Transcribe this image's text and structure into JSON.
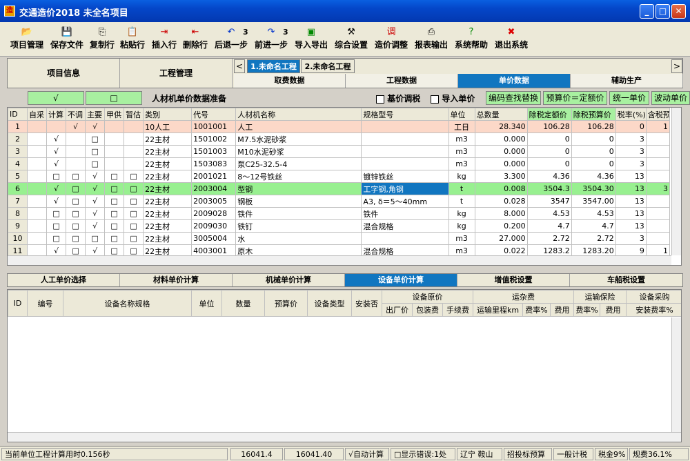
{
  "window": {
    "title": "交通造价2018  未全名项目",
    "app_icon": "造"
  },
  "toolbar": [
    {
      "label": "项目管理",
      "icon": "folder-icon",
      "glyph": "📂"
    },
    {
      "label": "保存文件",
      "icon": "save-icon",
      "glyph": "💾"
    },
    {
      "label": "复制行",
      "icon": "copy-icon",
      "glyph": "⎘"
    },
    {
      "label": "粘贴行",
      "icon": "paste-icon",
      "glyph": "📋"
    },
    {
      "label": "插入行",
      "icon": "insert-row-icon",
      "glyph": "⇥"
    },
    {
      "label": "删除行",
      "icon": "delete-row-icon",
      "glyph": "⇤"
    },
    {
      "label": "后退一步",
      "icon": "undo-icon",
      "glyph": "↶",
      "count": "3"
    },
    {
      "label": "前进一步",
      "icon": "redo-icon",
      "glyph": "↷",
      "count": "3"
    },
    {
      "label": "导入导出",
      "icon": "excel-icon",
      "glyph": "▣"
    },
    {
      "label": "综合设置",
      "icon": "tools-icon",
      "glyph": "⚒"
    },
    {
      "label": "造价调整",
      "icon": "adjust-icon",
      "glyph": "调"
    },
    {
      "label": "报表输出",
      "icon": "printer-icon",
      "glyph": "⎙"
    },
    {
      "label": "系统帮助",
      "icon": "help-icon",
      "glyph": "?"
    },
    {
      "label": "退出系统",
      "icon": "exit-icon",
      "glyph": "✖"
    }
  ],
  "nav": {
    "project_info": "项目信息",
    "project_mgmt": "工程管理",
    "file_tabs": [
      "1.未命名工程",
      "2.未命名工程"
    ],
    "sub_tabs": [
      "取费数据",
      "工程数据",
      "单价数据",
      "辅助生产"
    ]
  },
  "filter": {
    "btn_check": "√",
    "btn_box": "□",
    "title": "人材机单价数据准备",
    "chk1": "基价调税",
    "chk2": "导入单价",
    "buttons": [
      "编码查找替换",
      "预算价＝定额价",
      "统一单价",
      "波动单价"
    ]
  },
  "grid1": {
    "headers": [
      "ID",
      "自采",
      "计算",
      "不调",
      "主要",
      "甲供",
      "暂估",
      "类别",
      "代号",
      "人材机名称",
      "规格型号",
      "单位",
      "总数量",
      "除税定额价",
      "除税预算价",
      "税率(%)",
      "含税预"
    ],
    "rows": [
      [
        "1",
        "",
        "",
        "√",
        "√",
        "",
        "",
        "10人工",
        "1001001",
        "人工",
        "",
        "工日",
        "28.340",
        "106.28",
        "106.28",
        "0",
        "1"
      ],
      [
        "2",
        "",
        "√",
        "",
        "□",
        "",
        "",
        "22主材",
        "1501002",
        "M7.5水泥砂浆",
        "",
        "m3",
        "0.000",
        "0",
        "0",
        "3",
        ""
      ],
      [
        "3",
        "",
        "√",
        "",
        "□",
        "",
        "",
        "22主材",
        "1501003",
        "M10水泥砂浆",
        "",
        "m3",
        "0.000",
        "0",
        "0",
        "3",
        ""
      ],
      [
        "4",
        "",
        "√",
        "",
        "□",
        "",
        "",
        "22主材",
        "1503083",
        "泵C25-32.5-4",
        "",
        "m3",
        "0.000",
        "0",
        "0",
        "3",
        ""
      ],
      [
        "5",
        "",
        "□",
        "□",
        "√",
        "□",
        "□",
        "22主材",
        "2001021",
        "8～12号铁丝",
        "镀锌铁丝",
        "kg",
        "3.300",
        "4.36",
        "4.36",
        "13",
        ""
      ],
      [
        "6",
        "",
        "√",
        "□",
        "√",
        "□",
        "□",
        "22主材",
        "2003004",
        "型钢",
        "工字钢,角钢",
        "t",
        "0.008",
        "3504.3",
        "3504.30",
        "13",
        "3"
      ],
      [
        "7",
        "",
        "√",
        "□",
        "√",
        "□",
        "□",
        "22主材",
        "2003005",
        "钢板",
        "A3, δ＝5～40mm",
        "t",
        "0.028",
        "3547",
        "3547.00",
        "13",
        ""
      ],
      [
        "8",
        "",
        "□",
        "□",
        "√",
        "□",
        "□",
        "22主材",
        "2009028",
        "铁件",
        "铁件",
        "kg",
        "8.000",
        "4.53",
        "4.53",
        "13",
        ""
      ],
      [
        "9",
        "",
        "□",
        "□",
        "√",
        "□",
        "□",
        "22主材",
        "2009030",
        "铁钉",
        "混合规格",
        "kg",
        "0.200",
        "4.7",
        "4.7",
        "13",
        ""
      ],
      [
        "10",
        "",
        "□",
        "□",
        "□",
        "□",
        "□",
        "22主材",
        "3005004",
        "水",
        "",
        "m3",
        "27.000",
        "2.72",
        "2.72",
        "3",
        ""
      ],
      [
        "11",
        "",
        "√",
        "□",
        "√",
        "□",
        "□",
        "22主材",
        "4003001",
        "原木",
        "混合规格",
        "m3",
        "0.022",
        "1283.2",
        "1283.20",
        "9",
        "1"
      ]
    ]
  },
  "bottom_tabs": [
    "人工单价选择",
    "材料单价计算",
    "机械单价计算",
    "设备单价计算",
    "增值税设置",
    "车船税设置"
  ],
  "grid2": {
    "h1": [
      "ID",
      "编号",
      "设备名称规格",
      "单位",
      "数量",
      "预算价",
      "设备类型",
      "安装否",
      "设备原价",
      "运杂费",
      "运输保险",
      "设备采购"
    ],
    "h2": [
      "出厂价",
      "包装费",
      "手续费",
      "运输里程km",
      "费率%",
      "费用",
      "费率%",
      "费用",
      "安装费率%"
    ]
  },
  "status": {
    "calc_time": "当前单位工程计算用时0.156秒",
    "v1": "16041.4",
    "v2": "16041.40",
    "auto": "√自动计算",
    "errors": "□显示错误:1处",
    "region": "辽宁  鞍山",
    "mode": "招投标预算",
    "tax_mode": "一般计税",
    "tax": "税金9%",
    "fee": "规费36.1%"
  }
}
